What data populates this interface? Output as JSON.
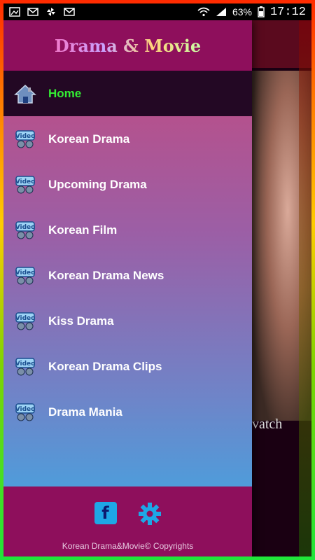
{
  "status_bar": {
    "battery": "63%",
    "time": "17:12"
  },
  "app": {
    "title": "Drama & Movie"
  },
  "background": {
    "caption": "vatch"
  },
  "menu": {
    "items": [
      {
        "label": "Home",
        "icon": "home-icon"
      },
      {
        "label": "Korean Drama",
        "icon": "video-icon"
      },
      {
        "label": "Upcoming Drama",
        "icon": "video-icon"
      },
      {
        "label": "Korean Film",
        "icon": "video-icon"
      },
      {
        "label": "Korean Drama News",
        "icon": "video-icon"
      },
      {
        "label": "Kiss Drama",
        "icon": "video-icon"
      },
      {
        "label": "Korean Drama Clips",
        "icon": "video-icon"
      },
      {
        "label": "Drama Mania",
        "icon": "video-icon"
      }
    ]
  },
  "footer": {
    "facebook_label": "f",
    "copyright": "Korean Drama&Movie© Copyrights"
  },
  "colors": {
    "drawer_header": "#8e0f5c",
    "active_item_text": "#33ee33",
    "active_item_bg": "#230824"
  }
}
